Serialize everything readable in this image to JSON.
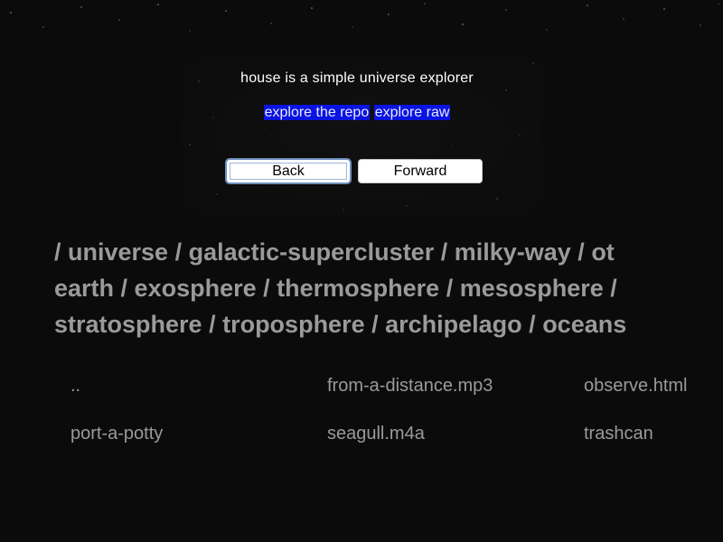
{
  "header": {
    "tagline": "house is a simple universe explorer",
    "links": [
      {
        "label": "explore the repo"
      },
      {
        "label": "explore raw"
      }
    ]
  },
  "navigation": {
    "back_label": "Back",
    "forward_label": "Forward"
  },
  "breadcrumb": {
    "line1": [
      {
        "sep": "/ ",
        "label": "universe"
      },
      {
        "sep": " / ",
        "label": "galactic-supercluster"
      },
      {
        "sep": " / ",
        "label": "milky-way"
      },
      {
        "sep": " / ",
        "label": "ot"
      }
    ],
    "line2": [
      {
        "sep": "",
        "label": "earth"
      },
      {
        "sep": " / ",
        "label": "exosphere"
      },
      {
        "sep": " / ",
        "label": "thermosphere"
      },
      {
        "sep": " / ",
        "label": "mesosphere"
      },
      {
        "sep": " /",
        "label": ""
      }
    ],
    "line3": [
      {
        "sep": "",
        "label": "stratosphere"
      },
      {
        "sep": " / ",
        "label": "troposphere"
      },
      {
        "sep": " / ",
        "label": "archipelago"
      },
      {
        "sep": " / ",
        "label": "oceans"
      }
    ]
  },
  "files": [
    {
      "name": ".."
    },
    {
      "name": "from-a-distance.mp3"
    },
    {
      "name": "observe.html"
    },
    {
      "name": "port-a-potty"
    },
    {
      "name": "seagull.m4a"
    },
    {
      "name": "trashcan"
    }
  ],
  "colors": {
    "background": "#0b0b0b",
    "link_highlight": "#0a14e0",
    "muted_text": "#9a9a9a"
  }
}
